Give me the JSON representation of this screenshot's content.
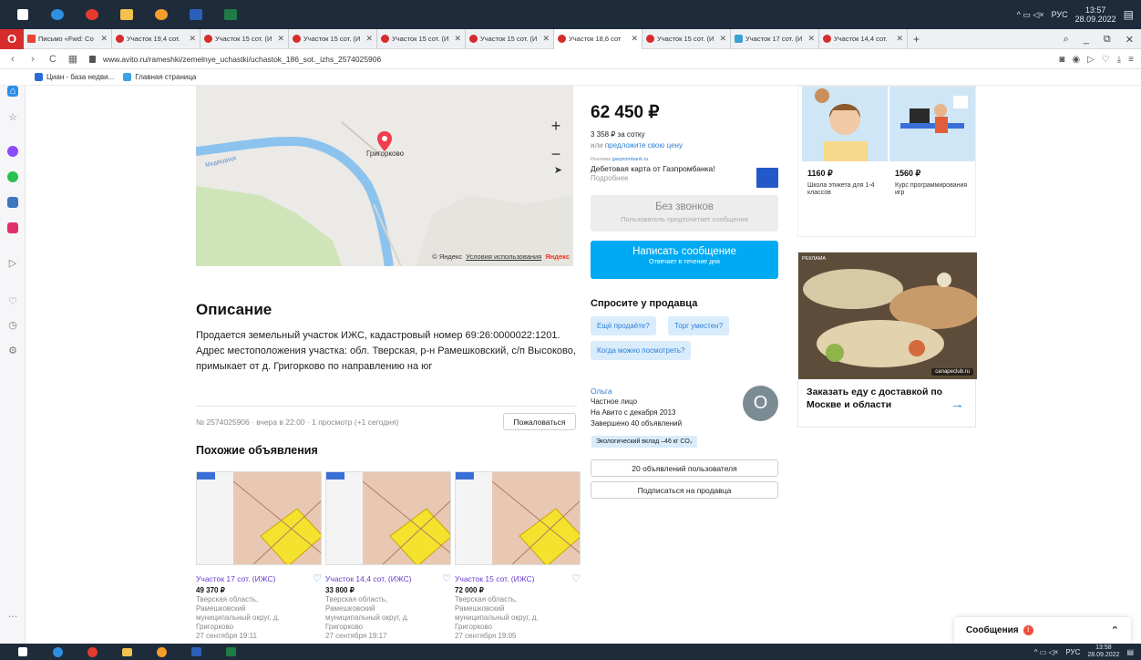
{
  "taskbar": {
    "lang": "РУС",
    "time_top": "13:57",
    "date_top": "28.09.2022",
    "time_bottom": "13:58",
    "date_bottom": "28.09.2022"
  },
  "tabs": [
    {
      "label": "Письмо «Fwd: Co",
      "icon": "mail-icon",
      "active": false
    },
    {
      "label": "Участок 19,4 сот.",
      "icon": "avito-icon",
      "active": false
    },
    {
      "label": "Участок 15 сот. (И",
      "icon": "avito-icon",
      "active": false
    },
    {
      "label": "Участок 15 сот. (И",
      "icon": "avito-icon",
      "active": false
    },
    {
      "label": "Участок 15 сот. (И",
      "icon": "avito-icon",
      "active": false
    },
    {
      "label": "Участок 15 сот. (И",
      "icon": "avito-icon",
      "active": false
    },
    {
      "label": "Участок 18,6 сот",
      "icon": "avito-icon",
      "active": true
    },
    {
      "label": "Участок 15 сот. (И",
      "icon": "avito-icon",
      "active": false
    },
    {
      "label": "Участок 17 сот. (И",
      "icon": "cian-icon",
      "active": false
    },
    {
      "label": "Участок 14,4 сот.",
      "icon": "avito-icon",
      "active": false
    }
  ],
  "address": {
    "url": "www.avito.ru/rameshki/zemelnye_uchastki/uchastok_186_sot._izhs_2574025906"
  },
  "bookmarks": [
    {
      "label": "Циан - база недви...",
      "color": "#2b6ad9"
    },
    {
      "label": "Главная страница",
      "color": "#3ba3e8"
    }
  ],
  "map": {
    "place": "Григорково",
    "river": "Медведица",
    "copyright": "© Яндекс",
    "terms": "Условия использования",
    "brand": "Яндекс",
    "zoom_in": "+",
    "zoom_out": "−"
  },
  "description": {
    "title": "Описание",
    "text": "Продается земельный участок ИЖС, кадастровый номер 69:26:0000022:1201. Адрес местоположения участка: обл. Тверская, р-н Рамешковский, с/п Высоково, примыкает от д. Григорково по направлению на юг"
  },
  "ad_meta": "№ 2574025906 · вчера в 22:00 · 1 просмотр (+1 сегодня)",
  "complain_label": "Пожаловаться",
  "similar": {
    "title": "Похожие объявления",
    "items": [
      {
        "title": "Участок 17 сот. (ИЖС)",
        "price": "49 370 ₽",
        "addr1": "Тверская область,",
        "addr2": "Рамешковский",
        "addr3": "муниципальный округ, д.",
        "addr4": "Григорково",
        "date": "27 сентября 19:11"
      },
      {
        "title": "Участок 14,4 сот. (ИЖС)",
        "price": "33 800 ₽",
        "addr1": "Тверская область,",
        "addr2": "Рамешковский",
        "addr3": "муниципальный округ, д.",
        "addr4": "Григорково",
        "date": "27 сентября 19:17"
      },
      {
        "title": "Участок 15 сот. (ИЖС)",
        "price": "72 000 ₽",
        "addr1": "Тверская область,",
        "addr2": "Рамешковский",
        "addr3": "муниципальный округ, д.",
        "addr4": "Григорково",
        "date": "27 сентября 19:05"
      }
    ]
  },
  "pricing": {
    "price": "62 450 ₽",
    "per_sotka": "3 358 ₽ за сотку",
    "offer_prefix": "или",
    "offer_link": "предложите свою цену"
  },
  "promo": {
    "label": "Реклама",
    "domain": "gazprombank.ru",
    "title": "Дебетовая карта от Газпромбанка!",
    "sub": "Подробнее"
  },
  "no_calls": {
    "title": "Без звонков",
    "sub": "Пользователь предпочитает сообщения"
  },
  "write_button": {
    "title": "Написать сообщение",
    "sub": "Отвечает в течение дня"
  },
  "ask": {
    "title": "Спросите у продавца",
    "chips": [
      "Ещё продаёте?",
      "Торг уместен?",
      "Когда можно посмотреть?"
    ]
  },
  "seller": {
    "name": "Ольга",
    "type": "Частное лицо",
    "since": "На Авито с декабря 2013",
    "completed": "Завершено 40 объявлений",
    "avatar_letter": "О",
    "eco": "Экологический вклад –46 кг CO₂",
    "listings_btn": "20 объявлений пользователя",
    "subscribe_btn": "Подписаться на продавца"
  },
  "right_ads": {
    "items": [
      {
        "price": "1160 ₽",
        "caption": "Школа этикета для 1-4 классов"
      },
      {
        "price": "1560 ₽",
        "caption": "Курс программирования игр"
      }
    ],
    "food": {
      "label": "РЕКЛАМА",
      "badge": "canapeclub.ru",
      "text": "Заказать еду с доставкой по Москве и области"
    }
  },
  "messages": {
    "label": "Сообщения",
    "badge": "!"
  }
}
